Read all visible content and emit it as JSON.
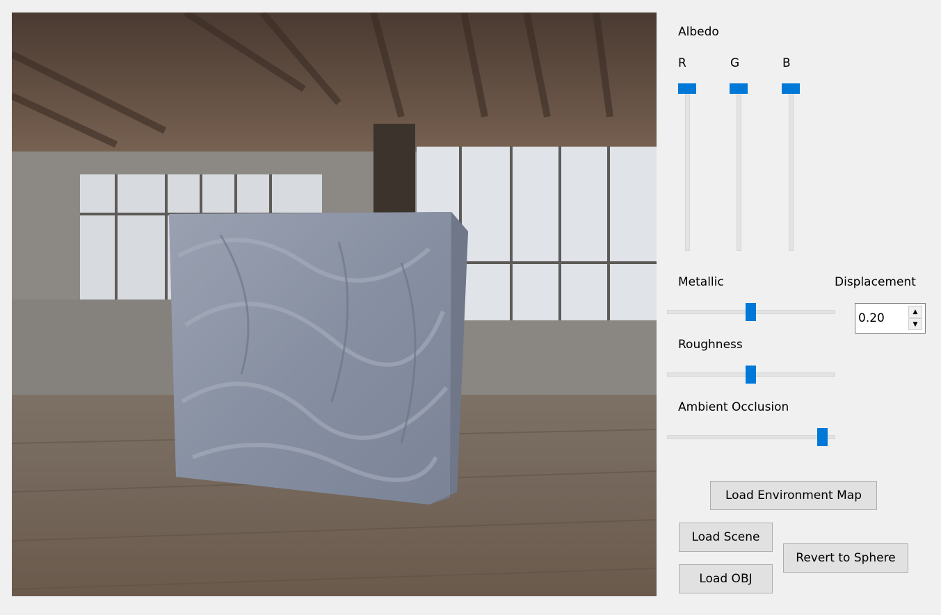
{
  "albedo": {
    "title": "Albedo",
    "channels": [
      {
        "label": "R",
        "value": 1.0
      },
      {
        "label": "G",
        "value": 1.0
      },
      {
        "label": "B",
        "value": 1.0
      }
    ]
  },
  "metallic": {
    "label": "Metallic",
    "value": 0.5
  },
  "roughness": {
    "label": "Roughness",
    "value": 0.5
  },
  "ambient_occlusion": {
    "label": "Ambient Occlusion",
    "value": 0.96
  },
  "displacement": {
    "label": "Displacement",
    "value": "0.20"
  },
  "buttons": {
    "load_env_map": "Load Environment Map",
    "load_scene": "Load Scene",
    "load_obj": "Load OBJ",
    "revert_sphere": "Revert to Sphere"
  },
  "icons": {
    "spin_up": "arrow-up-icon",
    "spin_down": "arrow-down-icon"
  },
  "colors": {
    "accent": "#0078d7",
    "panel_bg": "#f0f0f0",
    "cube": "#8f96a6"
  }
}
